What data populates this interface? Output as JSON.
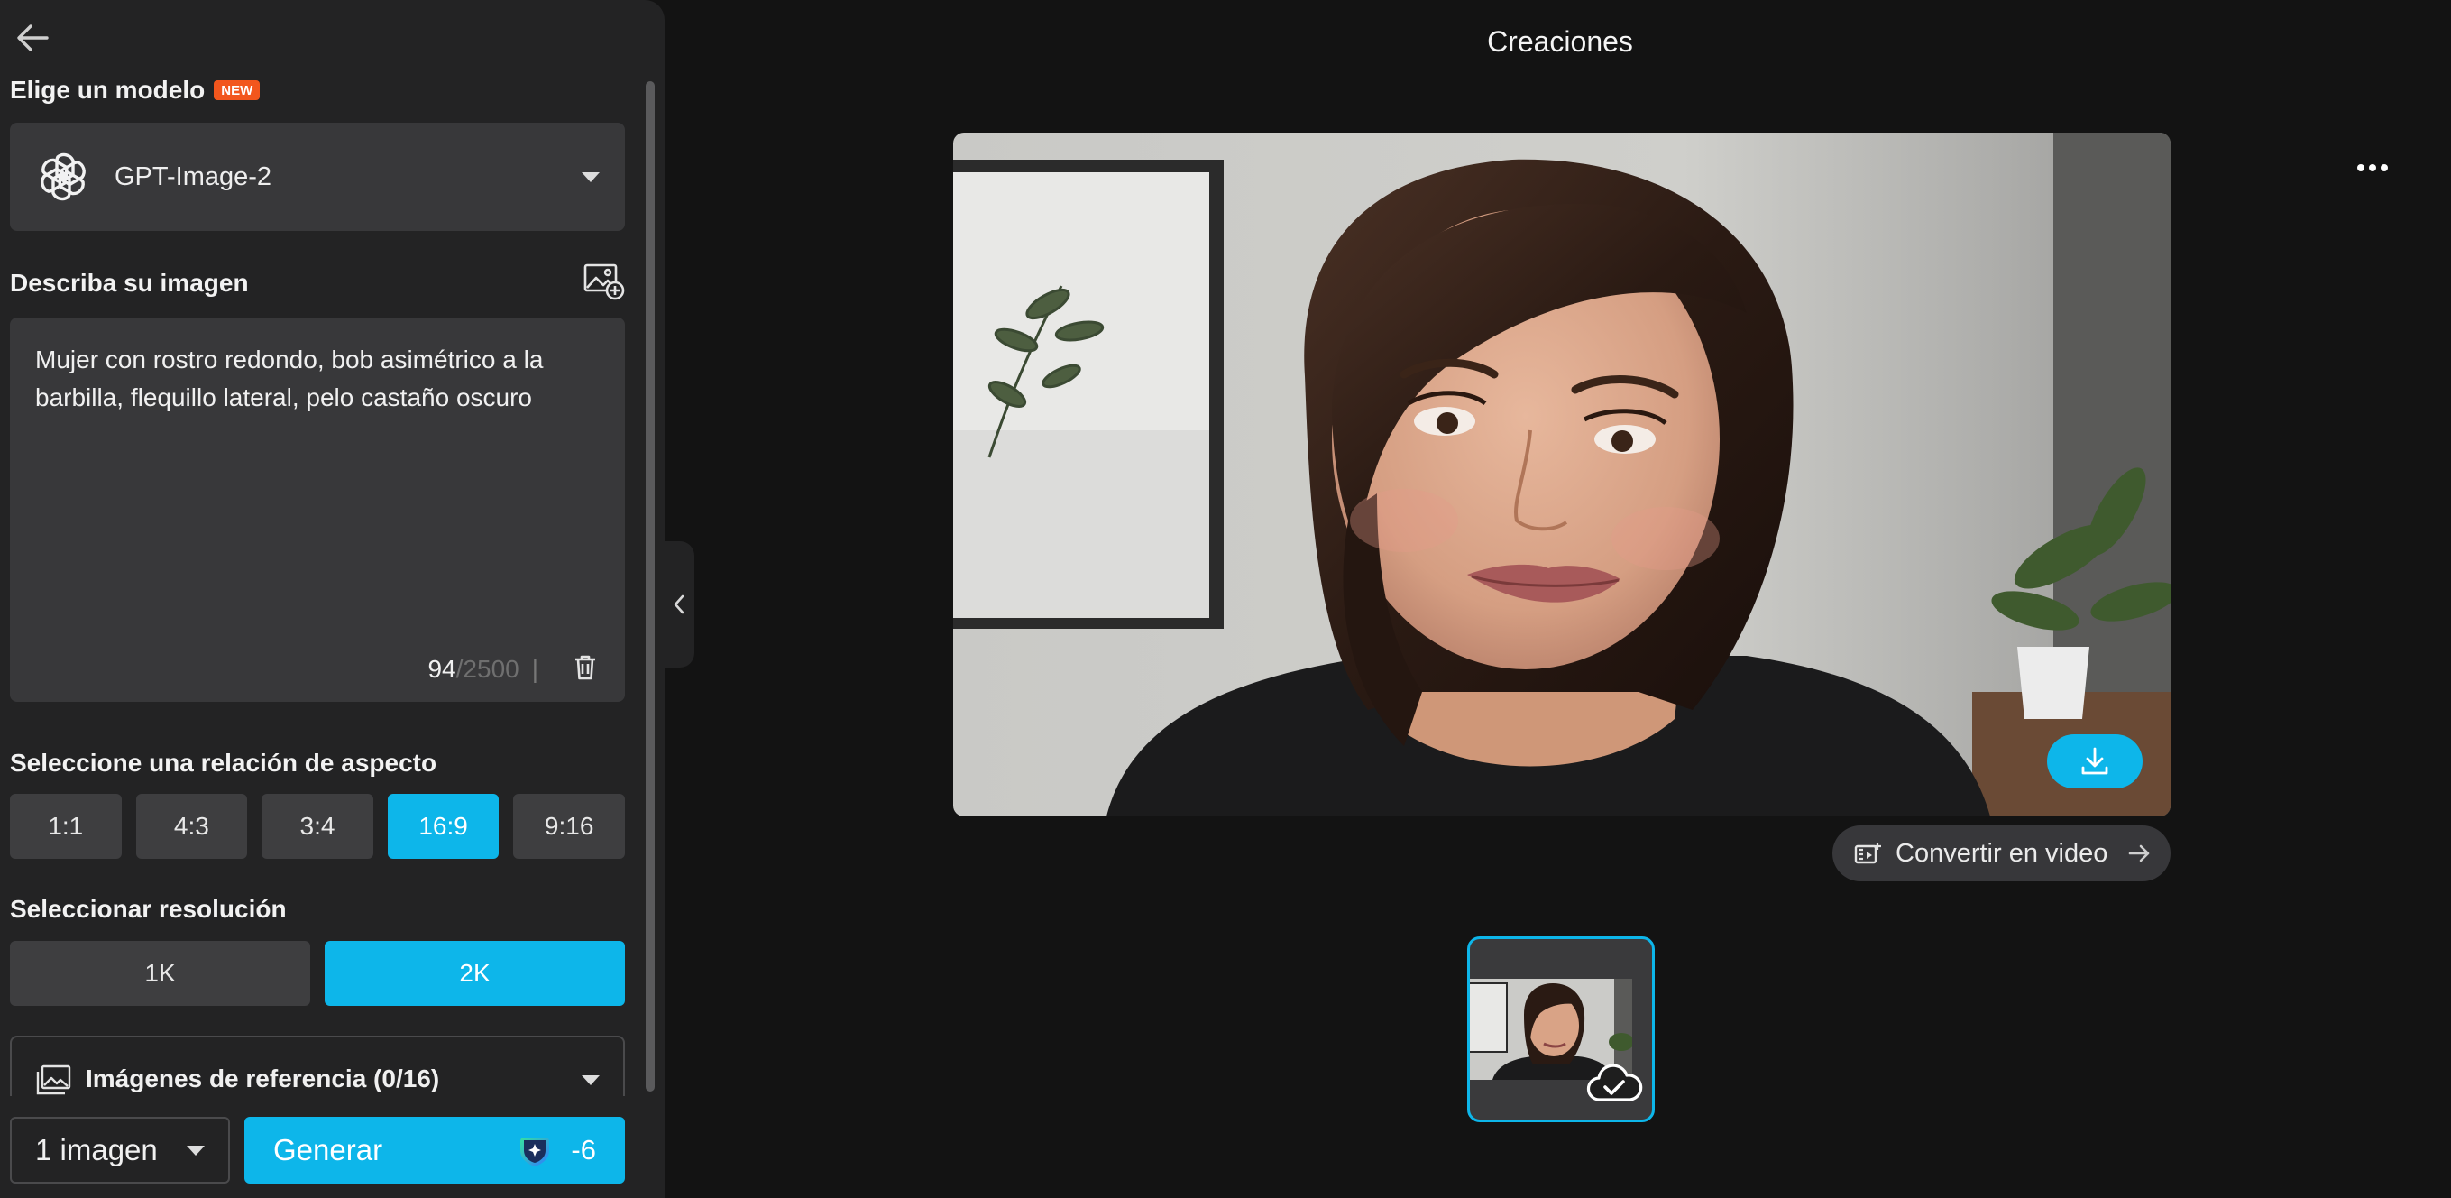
{
  "sidebar": {
    "model_section_label": "Elige un modelo",
    "new_badge": "NEW",
    "model_name": "GPT-Image-2",
    "prompt_section_label": "Describa su imagen",
    "prompt_text": "Mujer con rostro redondo, bob asimétrico a la barbilla, flequillo lateral, pelo castaño oscuro",
    "char_count": "94",
    "char_limit": "/2500",
    "counter_sep": "|",
    "aspect_label": "Seleccione una relación de aspecto",
    "aspect_options": [
      "1:1",
      "4:3",
      "3:4",
      "16:9",
      "9:16"
    ],
    "aspect_selected": "16:9",
    "resolution_label": "Seleccionar resolución",
    "resolution_options": [
      "1K",
      "2K"
    ],
    "resolution_selected": "2K",
    "reference_label": "Imágenes de referencia (0/16)",
    "image_count": "1 imagen",
    "generate_label": "Generar",
    "generate_cost": "-6"
  },
  "main": {
    "title": "Creaciones",
    "convert_label": "Convertir en video"
  },
  "colors": {
    "accent": "#0db6ea",
    "badge": "#f2561d",
    "panel": "#232324",
    "background": "#131313"
  },
  "icons": {
    "back": "arrow-left-icon",
    "model": "openai-logo-icon",
    "add_image": "image-add-icon",
    "trash": "trash-icon",
    "reference": "images-icon",
    "credit": "credit-icon",
    "more": "more-horizontal-icon",
    "download": "download-icon",
    "convert": "video-convert-icon",
    "cloud": "cloud-check-icon",
    "collapse": "chevron-left-icon"
  }
}
